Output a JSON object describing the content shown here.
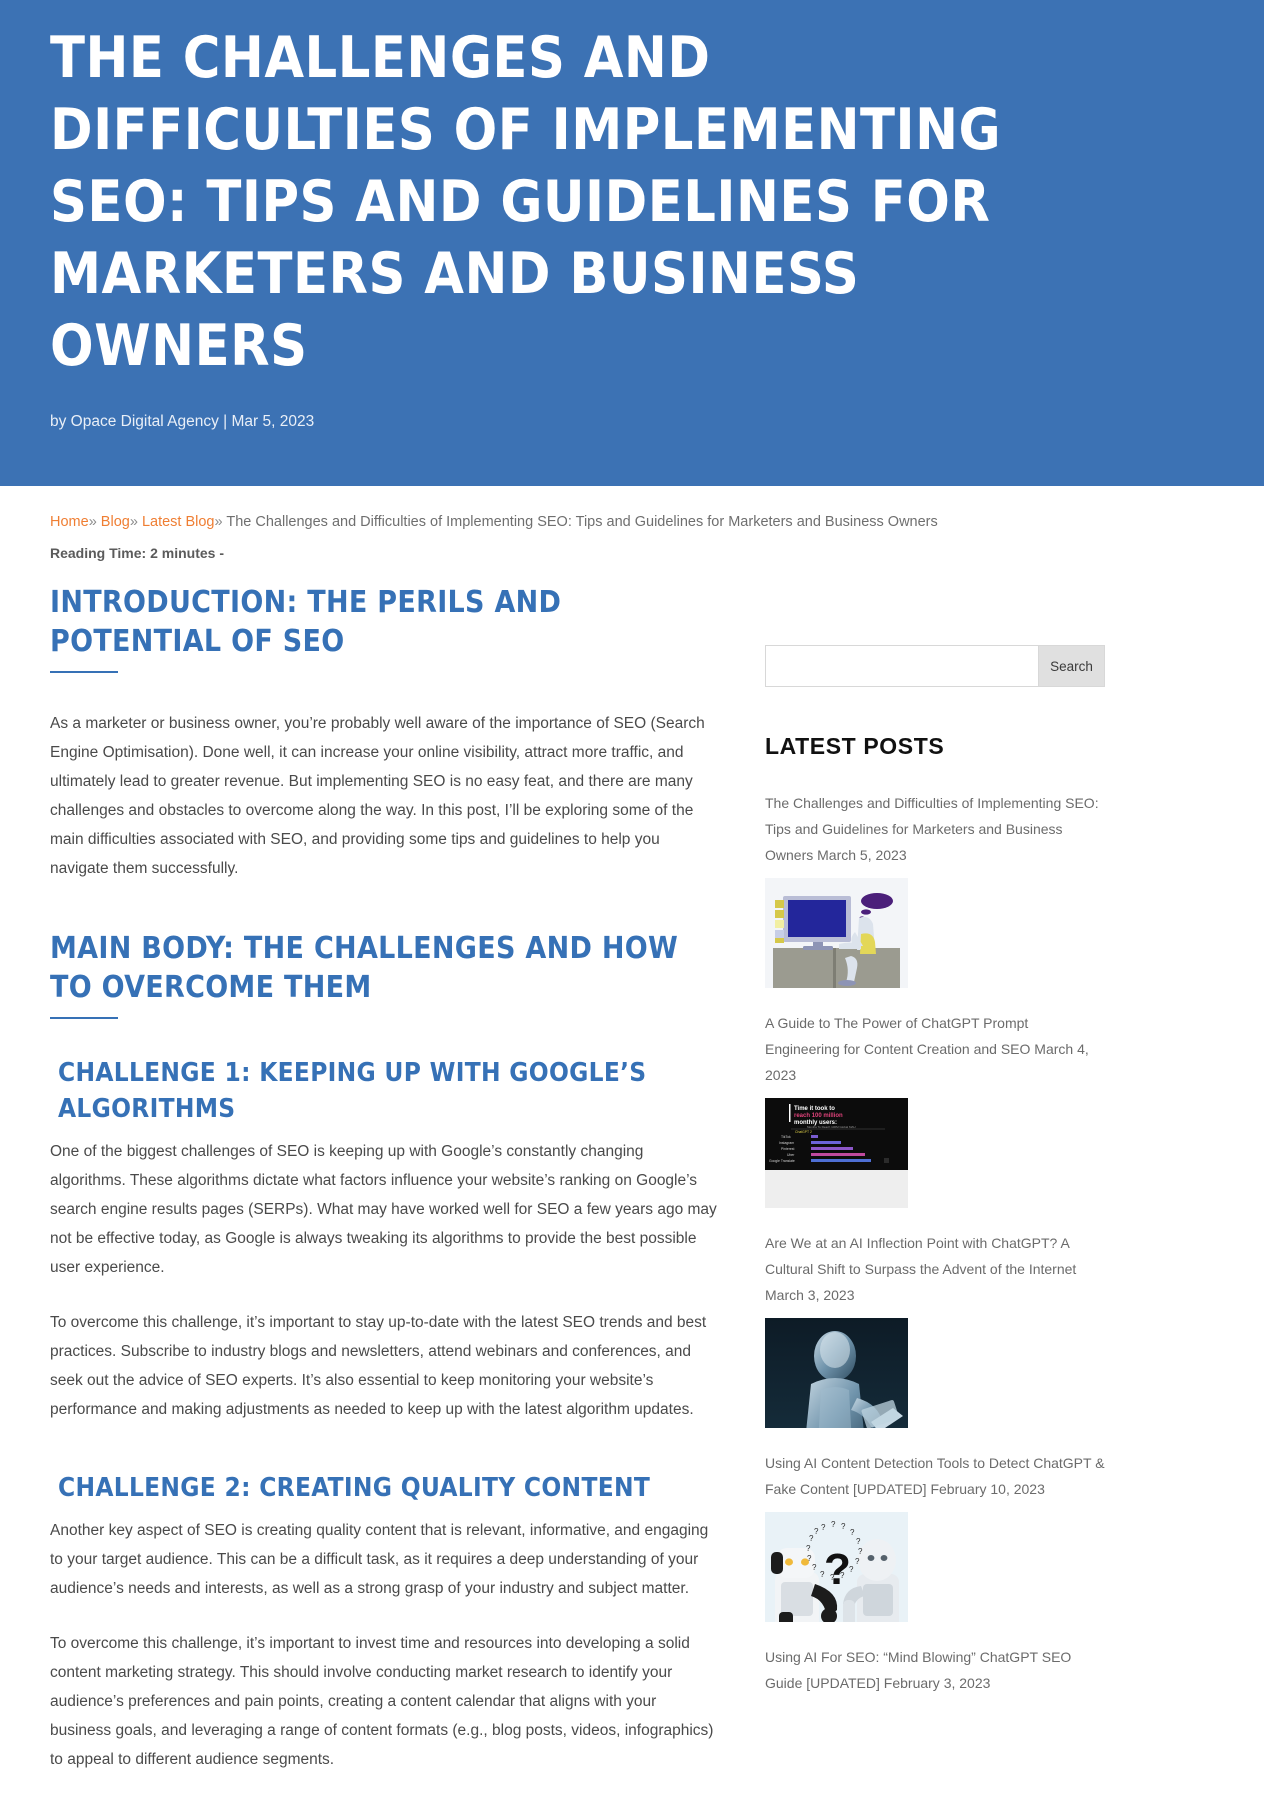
{
  "hero": {
    "title": "The Challenges and Difficulties of Implementing SEO: Tips and Guidelines for Marketers and Business Owners",
    "byline": "by Opace Digital Agency | Mar 5, 2023",
    "background_color": "#3c72b4"
  },
  "breadcrumb": {
    "home": "Home",
    "blog": "Blog",
    "latest_blog": "Latest Blog",
    "separator": "»",
    "current": "The Challenges and Difficulties of Implementing SEO: Tips and Guidelines for Marketers and Business Owners",
    "link_color": "#ef7e33"
  },
  "reading_time": "Reading Time: 2 minutes -",
  "main": {
    "heading_color": "#3671b6",
    "intro_heading": "Introduction: The Perils and Potential of SEO",
    "intro_paragraph": "As a marketer or business owner, you’re probably well aware of the importance of SEO (Search Engine Optimisation). Done well, it can increase your online visibility, attract more traffic, and ultimately lead to greater revenue. But implementing SEO is no easy feat, and there are many challenges and obstacles to overcome along the way. In this post, I’ll be exploring some of the main difficulties associated with SEO, and providing some tips and guidelines to help you navigate them successfully.",
    "body_heading": "Main Body: The Challenges and How to Overcome Them",
    "challenge1_heading": "Challenge 1: Keeping Up with Google’s Algorithms",
    "challenge1_p1": "One of the biggest challenges of SEO is keeping up with Google’s constantly changing algorithms. These algorithms dictate what factors influence your website’s ranking on Google’s search engine results pages (SERPs). What may have worked well for SEO a few years ago may not be effective today, as Google is always tweaking its algorithms to provide the best possible user experience.",
    "challenge1_p2": "To overcome this challenge, it’s important to stay up-to-date with the latest SEO trends and best practices. Subscribe to industry blogs and newsletters, attend webinars and conferences, and seek out the advice of SEO experts. It’s also essential to keep monitoring your website’s performance and making adjustments as needed to keep up with the latest algorithm updates.",
    "challenge2_heading": "Challenge 2: Creating Quality Content",
    "challenge2_p1": "Another key aspect of SEO is creating quality content that is relevant, informative, and engaging to your target audience. This can be a difficult task, as it requires a deep understanding of your audience’s needs and interests, as well as a strong grasp of your industry and subject matter.",
    "challenge2_p2": "To overcome this challenge, it’s important to invest time and resources into developing a solid content marketing strategy. This should involve conducting market research to identify your audience’s preferences and pain points, creating a content calendar that aligns with your business goals, and leveraging a range of content formats (e.g., blog posts, videos, infographics) to appeal to different audience segments."
  },
  "sidebar": {
    "search": {
      "value": "",
      "placeholder": "",
      "button_label": "Search"
    },
    "latest_posts_title": "Latest Posts",
    "posts": [
      {
        "title": "The Challenges and Difficulties of Implementing SEO: Tips and Guidelines for Marketers and Business Owners",
        "date": "March 5, 2023",
        "thumb": "person-at-computer-illustration"
      },
      {
        "title": "A Guide to The Power of ChatGPT Prompt Engineering for Content Creation and SEO",
        "date": "March 4, 2023",
        "thumb": "chatgpt-100-million-users-bar-chart"
      },
      {
        "title": "Are We at an AI Inflection Point with ChatGPT? A Cultural Shift to Surpass the Advent of the Internet",
        "date": "March 3, 2023",
        "thumb": "ai-robot-hand-hologram-photo"
      },
      {
        "title": "Using AI Content Detection Tools to Detect ChatGPT & Fake Content [UPDATED]",
        "date": "February 10, 2023",
        "thumb": "two-robots-question-mark-photo"
      },
      {
        "title": "Using AI For SEO: “Mind Blowing” ChatGPT SEO Guide [UPDATED]",
        "date": "February 3, 2023",
        "thumb": ""
      }
    ],
    "thumb2_labels": {
      "line1": "Time it took to",
      "line2_a": "reach ",
      "line2_b": "100 million",
      "line3": "monthly users:"
    }
  }
}
